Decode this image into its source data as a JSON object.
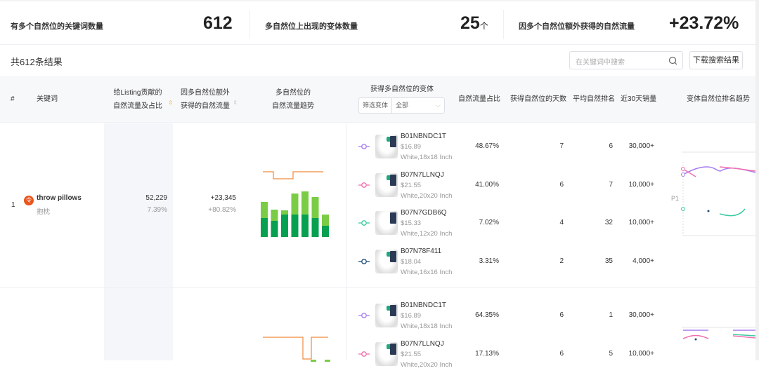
{
  "stats": [
    {
      "label": "有多个自然位的关键词数量",
      "value": "612",
      "unit": ""
    },
    {
      "label": "多自然位上出现的变体数量",
      "value": "25",
      "unit": "个"
    },
    {
      "label": "因多个自然位额外获得的自然流量",
      "value": "+23.72%",
      "unit": ""
    }
  ],
  "result_count": "共612条结果",
  "search": {
    "placeholder": "在关键词中搜索"
  },
  "download_label": "下载搜索结果",
  "headers": {
    "index": "#",
    "keyword": "关键词",
    "contrib_1": "给Listing贡献的",
    "contrib_2": "自然流量及占比",
    "extra_1": "因多自然位额外",
    "extra_2": "获得的自然流量",
    "trend_1": "多自然位的",
    "trend_2": "自然流量趋势",
    "variants": "获得多自然位的变体",
    "filter_label": "筛选变体",
    "filter_value": "全部",
    "share": "自然流量占比",
    "days": "获得自然位的天数",
    "rank": "平均自然排名",
    "sales": "近30天销量",
    "rank_trend": "变体自然位排名趋势"
  },
  "colors": {
    "purple": "#a77cf0",
    "pink": "#f06fb0",
    "teal": "#3cc9a0",
    "navy": "#1e4f7a",
    "orange": "#f08a3c",
    "green_light": "#7acc45",
    "green_dark": "#06a050"
  },
  "rows": [
    {
      "index": "1",
      "keyword": "throw pillows",
      "translation": "抱枕",
      "contrib": "52,229",
      "contrib_pct": "7.39%",
      "extra": "+23,345",
      "extra_pct": "+80.82%",
      "trend": {
        "total": [
          50,
          39,
          38,
          62,
          65,
          57,
          32
        ],
        "organic": [
          27,
          23,
          32,
          32,
          32,
          27,
          16
        ]
      },
      "rank_label": "P1",
      "variants": [
        {
          "asin": "B01NBNDC1T",
          "price": "$16.89",
          "attr": "White,18x18 Inch",
          "share": "48.67%",
          "days": "7",
          "rank": "6",
          "sales": "30,000+",
          "color": "purple"
        },
        {
          "asin": "B07N7LLNQJ",
          "price": "$21.55",
          "attr": "White,20x20 Inch",
          "share": "41.00%",
          "days": "6",
          "rank": "7",
          "sales": "10,000+",
          "color": "pink"
        },
        {
          "asin": "B07N7GDB6Q",
          "price": "$15.33",
          "attr": "White,12x20 Inch",
          "share": "7.02%",
          "days": "4",
          "rank": "32",
          "sales": "10,000+",
          "color": "teal"
        },
        {
          "asin": "B07N78F411",
          "price": "$18.04",
          "attr": "White,16x16 Inch",
          "share": "3.31%",
          "days": "2",
          "rank": "35",
          "sales": "4,000+",
          "color": "navy"
        }
      ]
    },
    {
      "index": "",
      "keyword": "",
      "translation": "",
      "contrib": "",
      "contrib_pct": "",
      "extra": "",
      "extra_pct": "",
      "variants": [
        {
          "asin": "B01NBNDC1T",
          "price": "$16.89",
          "attr": "White,18x18 Inch",
          "share": "64.35%",
          "days": "6",
          "rank": "1",
          "sales": "30,000+",
          "color": "purple"
        },
        {
          "asin": "B07N7LLNQJ",
          "price": "$21.55",
          "attr": "White,20x20 Inch",
          "share": "17.13%",
          "days": "6",
          "rank": "5",
          "sales": "10,000+",
          "color": "pink"
        }
      ]
    }
  ]
}
